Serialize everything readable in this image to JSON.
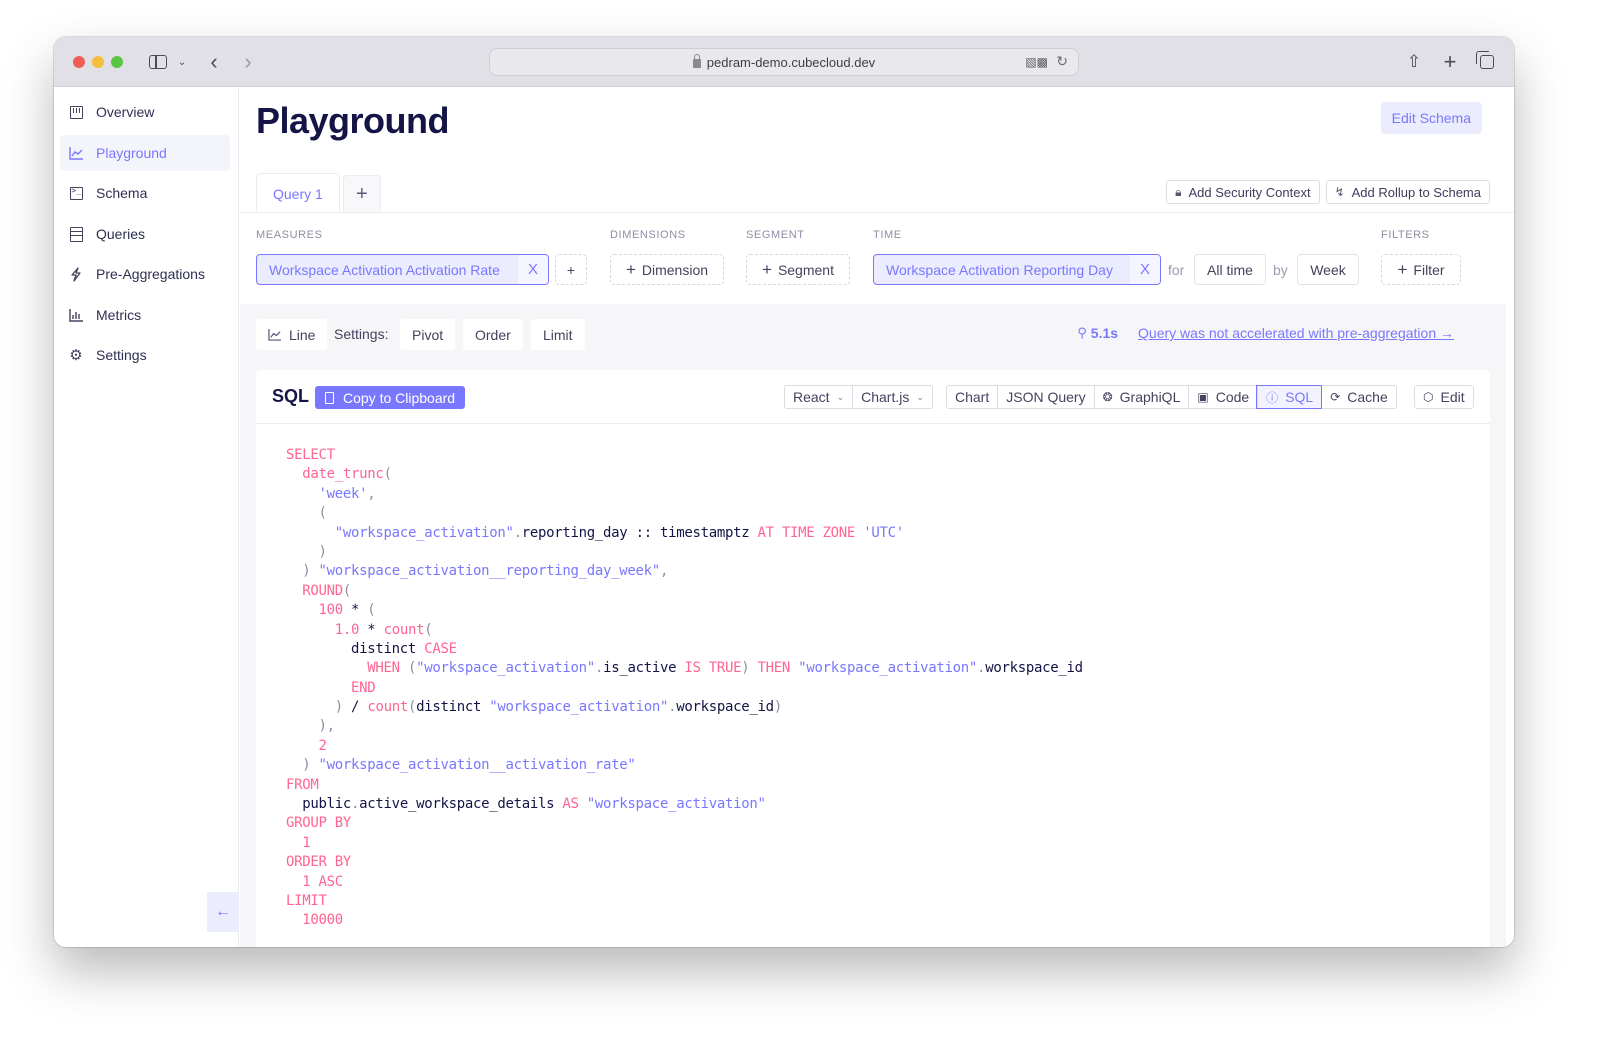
{
  "browser": {
    "url": "pedram-demo.cubecloud.dev"
  },
  "sidebar": {
    "items": [
      {
        "label": "Overview",
        "icon": "overview-icon",
        "active": false
      },
      {
        "label": "Playground",
        "icon": "line-chart-icon",
        "active": true
      },
      {
        "label": "Schema",
        "icon": "terminal-icon",
        "active": false
      },
      {
        "label": "Queries",
        "icon": "list-icon",
        "active": false
      },
      {
        "label": "Pre-Aggregations",
        "icon": "lightning-icon",
        "active": false
      },
      {
        "label": "Metrics",
        "icon": "bar-chart-icon",
        "active": false
      },
      {
        "label": "Settings",
        "icon": "gear-icon",
        "active": false
      }
    ],
    "collapse_icon": "arrow-left-icon"
  },
  "header": {
    "title": "Playground",
    "edit_schema_label": "Edit Schema"
  },
  "tabs": {
    "items": [
      {
        "label": "Query 1",
        "active": true
      }
    ],
    "add_label": "+"
  },
  "context_buttons": {
    "security": "Add Security Context",
    "rollup": "Add Rollup to Schema"
  },
  "query_builder": {
    "measures": {
      "label": "MEASURES",
      "selected": "Workspace Activation Activation Rate",
      "remove": "X",
      "add": "+"
    },
    "dimensions": {
      "label": "DIMENSIONS",
      "add_label": "Dimension"
    },
    "segment": {
      "label": "SEGMENT",
      "add_label": "Segment"
    },
    "time": {
      "label": "TIME",
      "selected": "Workspace Activation Reporting Day",
      "remove": "X",
      "for_word": "for",
      "range": "All time",
      "by_word": "by",
      "granularity": "Week"
    },
    "filters": {
      "label": "FILTERS",
      "add_label": "Filter"
    }
  },
  "results_toolbar": {
    "chart_type": "Line",
    "settings_label": "Settings:",
    "pivot": "Pivot",
    "order": "Order",
    "limit": "Limit",
    "duration": "5.1s",
    "accel_link": "Query was not accelerated with pre-aggregation →"
  },
  "sql_panel": {
    "title": "SQL",
    "copy_label": "Copy to Clipboard",
    "framework": "React",
    "chart_lib": "Chart.js",
    "view_tabs": [
      {
        "label": "Chart",
        "icon": "",
        "active": false
      },
      {
        "label": "JSON Query",
        "icon": "",
        "active": false
      },
      {
        "label": "GraphiQL",
        "icon": "graphql-icon",
        "active": false
      },
      {
        "label": "Code",
        "icon": "terminal-icon",
        "active": false
      },
      {
        "label": "SQL",
        "icon": "question-circle-icon",
        "active": true
      },
      {
        "label": "Cache",
        "icon": "refresh-icon",
        "active": false
      }
    ],
    "edit_label": "Edit",
    "code_lines": [
      [
        [
          "k",
          "SELECT"
        ]
      ],
      [
        [
          "t",
          "  "
        ],
        [
          "k",
          "date_trunc"
        ],
        [
          "p",
          "("
        ]
      ],
      [
        [
          "t",
          "    "
        ],
        [
          "s",
          "'week'"
        ],
        [
          "p",
          ","
        ]
      ],
      [
        [
          "t",
          "    "
        ],
        [
          "p",
          "("
        ]
      ],
      [
        [
          "t",
          "      "
        ],
        [
          "s",
          "\"workspace_activation\""
        ],
        [
          "p",
          "."
        ],
        [
          "t",
          "reporting_day :: timestamptz "
        ],
        [
          "k",
          "AT TIME ZONE "
        ],
        [
          "s",
          "'UTC'"
        ]
      ],
      [
        [
          "t",
          "    "
        ],
        [
          "p",
          ")"
        ]
      ],
      [
        [
          "t",
          "  "
        ],
        [
          "p",
          ") "
        ],
        [
          "s",
          "\"workspace_activation__reporting_day_week\""
        ],
        [
          "p",
          ","
        ]
      ],
      [
        [
          "t",
          "  "
        ],
        [
          "k",
          "ROUND"
        ],
        [
          "p",
          "("
        ]
      ],
      [
        [
          "t",
          "    "
        ],
        [
          "k",
          "100"
        ],
        [
          "t",
          " * "
        ],
        [
          "p",
          "("
        ]
      ],
      [
        [
          "t",
          "      "
        ],
        [
          "k",
          "1.0"
        ],
        [
          "t",
          " * "
        ],
        [
          "k",
          "count"
        ],
        [
          "p",
          "("
        ]
      ],
      [
        [
          "t",
          "        distinct "
        ],
        [
          "k",
          "CASE"
        ]
      ],
      [
        [
          "t",
          "          "
        ],
        [
          "k",
          "WHEN "
        ],
        [
          "p",
          "("
        ],
        [
          "s",
          "\"workspace_activation\""
        ],
        [
          "p",
          "."
        ],
        [
          "t",
          "is_active "
        ],
        [
          "k",
          "IS TRUE"
        ],
        [
          "p",
          ") "
        ],
        [
          "k",
          "THEN "
        ],
        [
          "s",
          "\"workspace_activation\""
        ],
        [
          "p",
          "."
        ],
        [
          "t",
          "workspace_id"
        ]
      ],
      [
        [
          "t",
          "        "
        ],
        [
          "k",
          "END"
        ]
      ],
      [
        [
          "t",
          "      "
        ],
        [
          "p",
          ")"
        ],
        [
          "t",
          " / "
        ],
        [
          "k",
          "count"
        ],
        [
          "p",
          "("
        ],
        [
          "t",
          "distinct "
        ],
        [
          "s",
          "\"workspace_activation\""
        ],
        [
          "p",
          "."
        ],
        [
          "t",
          "workspace_id"
        ],
        [
          "p",
          ")"
        ]
      ],
      [
        [
          "t",
          "    "
        ],
        [
          "p",
          "),"
        ]
      ],
      [
        [
          "t",
          "    "
        ],
        [
          "k",
          "2"
        ]
      ],
      [
        [
          "t",
          "  "
        ],
        [
          "p",
          ") "
        ],
        [
          "s",
          "\"workspace_activation__activation_rate\""
        ]
      ],
      [
        [
          "k",
          "FROM"
        ]
      ],
      [
        [
          "t",
          "  public"
        ],
        [
          "p",
          "."
        ],
        [
          "t",
          "active_workspace_details "
        ],
        [
          "k",
          "AS "
        ],
        [
          "s",
          "\"workspace_activation\""
        ]
      ],
      [
        [
          "k",
          "GROUP BY"
        ]
      ],
      [
        [
          "t",
          "  "
        ],
        [
          "k",
          "1"
        ]
      ],
      [
        [
          "k",
          "ORDER BY"
        ]
      ],
      [
        [
          "t",
          "  "
        ],
        [
          "k",
          "1 ASC"
        ]
      ],
      [
        [
          "k",
          "LIMIT"
        ]
      ],
      [
        [
          "t",
          "  "
        ],
        [
          "k",
          "10000"
        ]
      ]
    ]
  },
  "colors": {
    "accent": "#7a77ff",
    "accent_bg": "#ececff",
    "keyword": "#ff6492",
    "title": "#141446"
  }
}
